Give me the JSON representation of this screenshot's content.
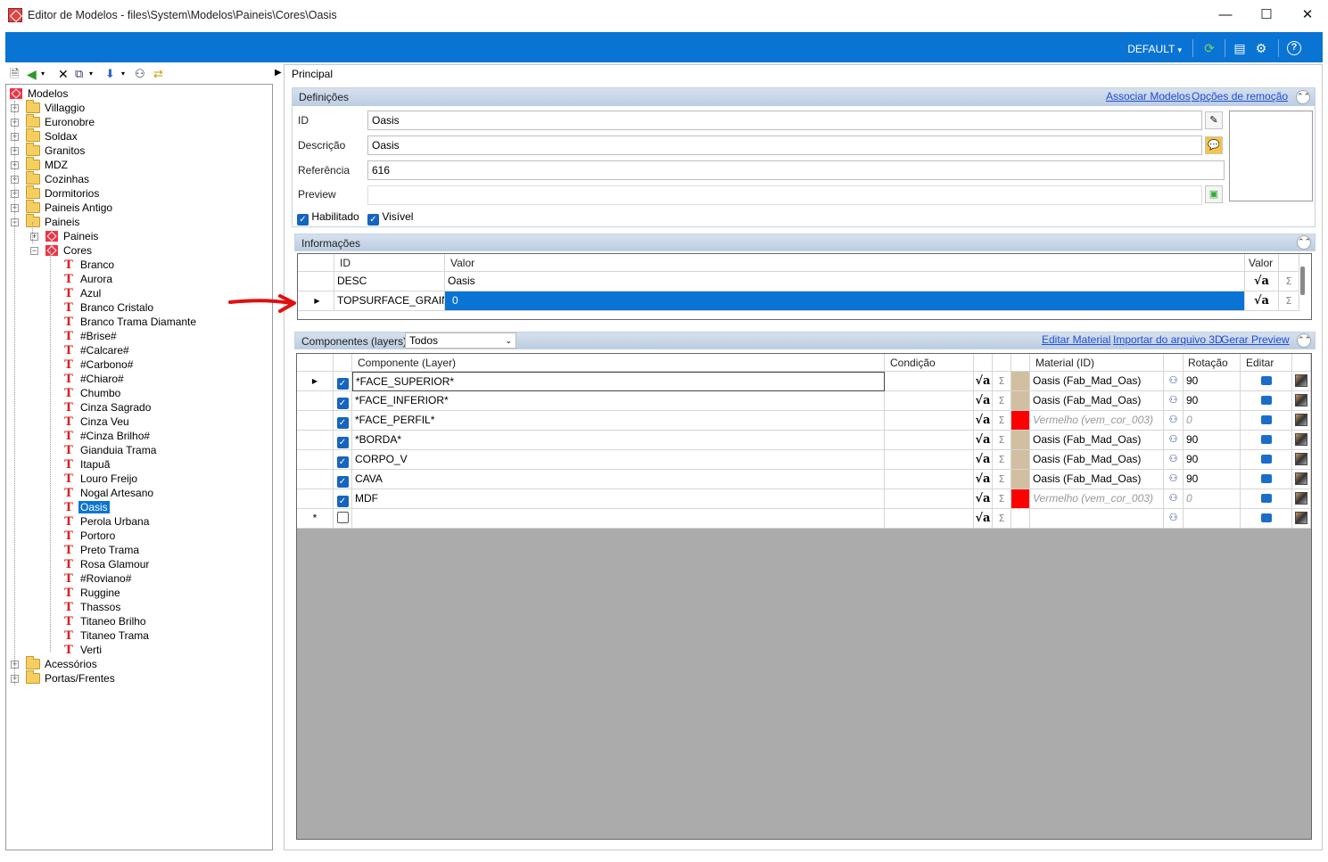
{
  "window": {
    "title": "Editor de Modelos - files\\System\\Modelos\\Paineis\\Cores\\Oasis",
    "minimize": "—",
    "maximize": "☐",
    "close": "✕"
  },
  "topbar": {
    "profile": "DEFAULT",
    "profile_arrow": "▾"
  },
  "tree": {
    "root": "Modelos",
    "folders_top": [
      "Villaggio",
      "Euronobre",
      "Soldax",
      "Granitos",
      "MDZ",
      "Cozinhas",
      "Dormitorios",
      "Paineis Antigo",
      "Paineis"
    ],
    "paineis_children": [
      "Paineis",
      "Cores"
    ],
    "cores": [
      "Branco",
      "Aurora",
      "Azul",
      "Branco Cristalo",
      "Branco Trama Diamante",
      "#Brise#",
      "#Calcare#",
      "#Carbono#",
      "#Chiaro#",
      "Chumbo",
      "Cinza Sagrado",
      "Cinza Veu",
      "#Cinza Brilho#",
      "Gianduia Trama",
      "Itapuã",
      "Louro Freijo",
      "Nogal Artesano",
      "Oasis",
      "Perola Urbana",
      "Portoro",
      "Preto Trama",
      "Rosa Glamour",
      "#Roviano#",
      "Ruggine",
      "Thassos",
      "Titaneo Brilho",
      "Titaneo Trama",
      "Verti"
    ],
    "folders_bottom": [
      "Acessórios",
      "Portas/Frentes"
    ],
    "selected": "Oasis"
  },
  "principal": "Principal",
  "definicoes": {
    "title": "Definições",
    "link_associar": "Associar Modelos",
    "link_opcoes": "Opções de remoção",
    "id_label": "ID",
    "id_value": "Oasis",
    "descricao_label": "Descrição",
    "descricao_value": "Oasis",
    "referencia_label": "Referência",
    "referencia_value": "616",
    "preview_label": "Preview",
    "preview_value": "",
    "habilitado": "Habilitado",
    "visivel": "Visível"
  },
  "informacoes": {
    "title": "Informações",
    "headers": {
      "id": "ID",
      "valor": "Valor",
      "valor2": "Valor"
    },
    "rows": [
      {
        "id": "DESC",
        "valor": "Oasis"
      },
      {
        "id": "TOPSURFACE_GRAIN",
        "valor": "0"
      }
    ]
  },
  "componentes": {
    "title": "Componentes (layers)",
    "filter": "Todos",
    "link_editar": "Editar Material",
    "link_importar": "Importar do arquivo 3D",
    "link_gerar": "Gerar Preview",
    "headers": {
      "componente": "Componente (Layer)",
      "condicao": "Condição",
      "material": "Material (ID)",
      "rotacao": "Rotação",
      "editar": "Editar"
    },
    "rows": [
      {
        "name": "*FACE_SUPERIOR*",
        "material": "Oasis (Fab_Mad_Oas)",
        "rot": "90",
        "color": "#d2bea0",
        "italic": false
      },
      {
        "name": "*FACE_INFERIOR*",
        "material": "Oasis (Fab_Mad_Oas)",
        "rot": "90",
        "color": "#d2bea0",
        "italic": false
      },
      {
        "name": "*FACE_PERFIL*",
        "material": "Vermelho (vem_cor_003)",
        "rot": "0",
        "color": "#ff0000",
        "italic": true
      },
      {
        "name": "*BORDA*",
        "material": "Oasis (Fab_Mad_Oas)",
        "rot": "90",
        "color": "#d2bea0",
        "italic": false
      },
      {
        "name": "CORPO_V",
        "material": "Oasis (Fab_Mad_Oas)",
        "rot": "90",
        "color": "#d2bea0",
        "italic": false
      },
      {
        "name": "CAVA",
        "material": "Oasis (Fab_Mad_Oas)",
        "rot": "90",
        "color": "#d2bea0",
        "italic": false
      },
      {
        "name": "MDF",
        "material": "Vermelho (vem_cor_003)",
        "rot": "0",
        "color": "#ff0000",
        "italic": true
      }
    ],
    "new_row_marker": "*"
  },
  "colors": {
    "accent": "#0a74d4",
    "grid_bg": "#ababab",
    "header_grad": "#c8d6e8"
  }
}
